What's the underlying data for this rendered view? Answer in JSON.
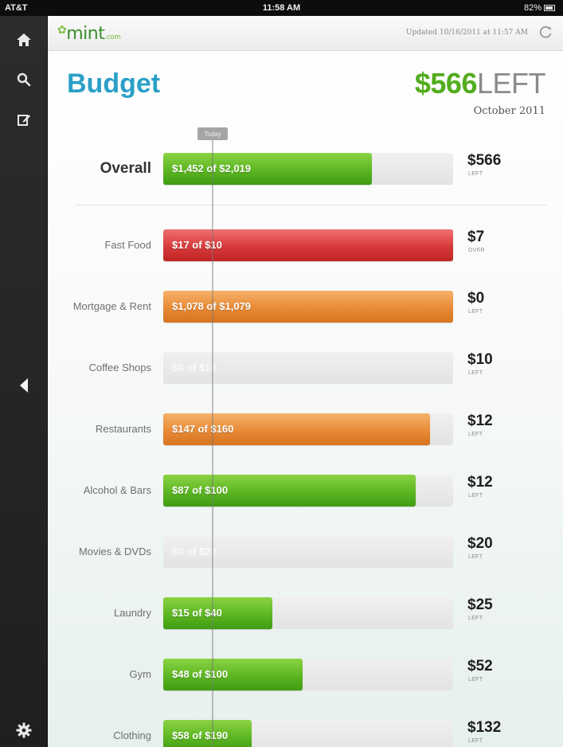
{
  "status_bar": {
    "carrier": "AT&T",
    "time": "11:58 AM",
    "battery": "82%"
  },
  "sidebar": {
    "items": [
      {
        "icon": "home-icon"
      },
      {
        "icon": "search-icon"
      },
      {
        "icon": "edit-icon"
      },
      {
        "icon": "back-arrow-icon"
      },
      {
        "icon": "settings-gear-icon"
      }
    ]
  },
  "header": {
    "logo": "mint",
    "logo_suffix": ".com",
    "updated": "Updated 10/16/2011 at 11:57 AM",
    "refresh_icon": "refresh-icon"
  },
  "budget": {
    "title": "Budget",
    "left_amount": "$566",
    "left_word": "LEFT",
    "month": "October 2011",
    "today_label": "Today"
  },
  "overall": {
    "name": "Overall",
    "label": "$1,452 of $2,019",
    "spent_fraction": 0.72,
    "color": "green",
    "remaining": "$566",
    "remaining_label": "LEFT"
  },
  "categories": [
    {
      "name": "Fast Food",
      "label": "$17 of $10",
      "spent_fraction": 1.0,
      "color": "red",
      "remaining": "$7",
      "remaining_label": "OVER"
    },
    {
      "name": "Mortgage & Rent",
      "label": "$1,078 of $1,079",
      "spent_fraction": 1.0,
      "color": "orange",
      "remaining": "$0",
      "remaining_label": "LEFT"
    },
    {
      "name": "Coffee Shops",
      "label": "$0 of $10",
      "spent_fraction": 0.0,
      "color": "green",
      "remaining": "$10",
      "remaining_label": "LEFT"
    },
    {
      "name": "Restaurants",
      "label": "$147 of $160",
      "spent_fraction": 0.92,
      "color": "orange",
      "remaining": "$12",
      "remaining_label": "LEFT"
    },
    {
      "name": "Alcohol & Bars",
      "label": "$87 of $100",
      "spent_fraction": 0.87,
      "color": "green",
      "remaining": "$12",
      "remaining_label": "LEFT"
    },
    {
      "name": "Movies & DVDs",
      "label": "$0 of $20",
      "spent_fraction": 0.0,
      "color": "green",
      "remaining": "$20",
      "remaining_label": "LEFT"
    },
    {
      "name": "Laundry",
      "label": "$15 of $40",
      "spent_fraction": 0.375,
      "color": "green",
      "remaining": "$25",
      "remaining_label": "LEFT"
    },
    {
      "name": "Gym",
      "label": "$48 of $100",
      "spent_fraction": 0.48,
      "color": "green",
      "remaining": "$52",
      "remaining_label": "LEFT"
    },
    {
      "name": "Clothing",
      "label": "$58 of $190",
      "spent_fraction": 0.305,
      "color": "green",
      "remaining": "$132",
      "remaining_label": "LEFT"
    }
  ],
  "colors": {
    "title_blue": "#2aa0c8",
    "left_green": "#52ad1e",
    "bar_green": "#5cb622",
    "bar_red": "#d63a3a",
    "bar_orange": "#e78a36",
    "sidebar_bg": "#2c2c2c"
  }
}
